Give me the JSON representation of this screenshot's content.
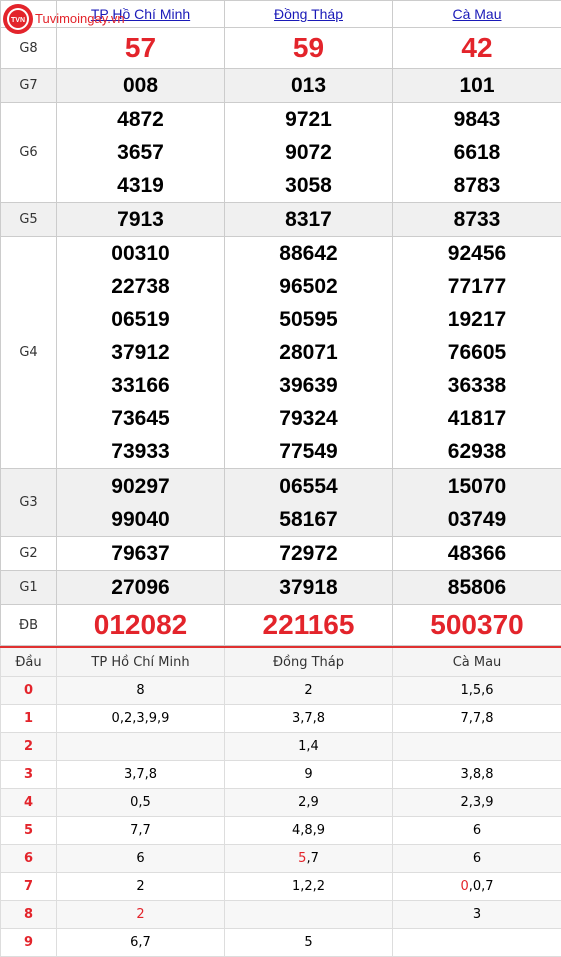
{
  "logo": {
    "text": "Tuvimoingay.vn",
    "badge": "TVN"
  },
  "provinces": [
    "TP Hồ Chí Minh",
    "Đồng Tháp",
    "Cà Mau"
  ],
  "prizes": [
    {
      "label": "G8",
      "values": [
        [
          "57"
        ],
        [
          "59"
        ],
        [
          "42"
        ]
      ]
    },
    {
      "label": "G7",
      "values": [
        [
          "008"
        ],
        [
          "013"
        ],
        [
          "101"
        ]
      ]
    },
    {
      "label": "G6",
      "values": [
        [
          "4872",
          "3657",
          "4319"
        ],
        [
          "9721",
          "9072",
          "3058"
        ],
        [
          "9843",
          "6618",
          "8783"
        ]
      ]
    },
    {
      "label": "G5",
      "values": [
        [
          "7913"
        ],
        [
          "8317"
        ],
        [
          "8733"
        ]
      ]
    },
    {
      "label": "G4",
      "values": [
        [
          "00310",
          "22738",
          "06519",
          "37912",
          "33166",
          "73645",
          "73933"
        ],
        [
          "88642",
          "96502",
          "50595",
          "28071",
          "39639",
          "79324",
          "77549"
        ],
        [
          "92456",
          "77177",
          "19217",
          "76605",
          "36338",
          "41817",
          "62938"
        ]
      ]
    },
    {
      "label": "G3",
      "values": [
        [
          "90297",
          "99040"
        ],
        [
          "06554",
          "58167"
        ],
        [
          "15070",
          "03749"
        ]
      ]
    },
    {
      "label": "G2",
      "values": [
        [
          "79637"
        ],
        [
          "72972"
        ],
        [
          "48366"
        ]
      ]
    },
    {
      "label": "G1",
      "values": [
        [
          "27096"
        ],
        [
          "37918"
        ],
        [
          "85806"
        ]
      ]
    },
    {
      "label": "ĐB",
      "values": [
        [
          "012082"
        ],
        [
          "221165"
        ],
        [
          "500370"
        ]
      ]
    }
  ],
  "loto_header": {
    "dau": "Đầu",
    "cols": [
      "TP Hồ Chí Minh",
      "Đồng Tháp",
      "Cà Mau"
    ]
  },
  "loto_rows": [
    {
      "dau": "0",
      "vals": [
        "8",
        "2",
        "1,5,6"
      ]
    },
    {
      "dau": "1",
      "vals": [
        "0,2,3,9,9",
        "3,7,8",
        "7,7,8"
      ]
    },
    {
      "dau": "2",
      "vals": [
        "",
        "1,4",
        ""
      ]
    },
    {
      "dau": "3",
      "vals": [
        "3,7,8",
        "9",
        "3,8,8"
      ]
    },
    {
      "dau": "4",
      "vals": [
        "0,5",
        "2,9",
        "2,3,9"
      ]
    },
    {
      "dau": "5",
      "vals": [
        "7,7",
        "4,8,9",
        "6"
      ]
    },
    {
      "dau": "6",
      "vals": [
        "6",
        "5,7",
        "6"
      ]
    },
    {
      "dau": "7",
      "vals": [
        "2",
        "1,2,2",
        "0,0,7"
      ]
    },
    {
      "dau": "8",
      "vals": [
        "2",
        "",
        "3"
      ]
    },
    {
      "dau": "9",
      "vals": [
        "6,7",
        "5",
        ""
      ]
    }
  ],
  "highlight_color": "#e3242b"
}
